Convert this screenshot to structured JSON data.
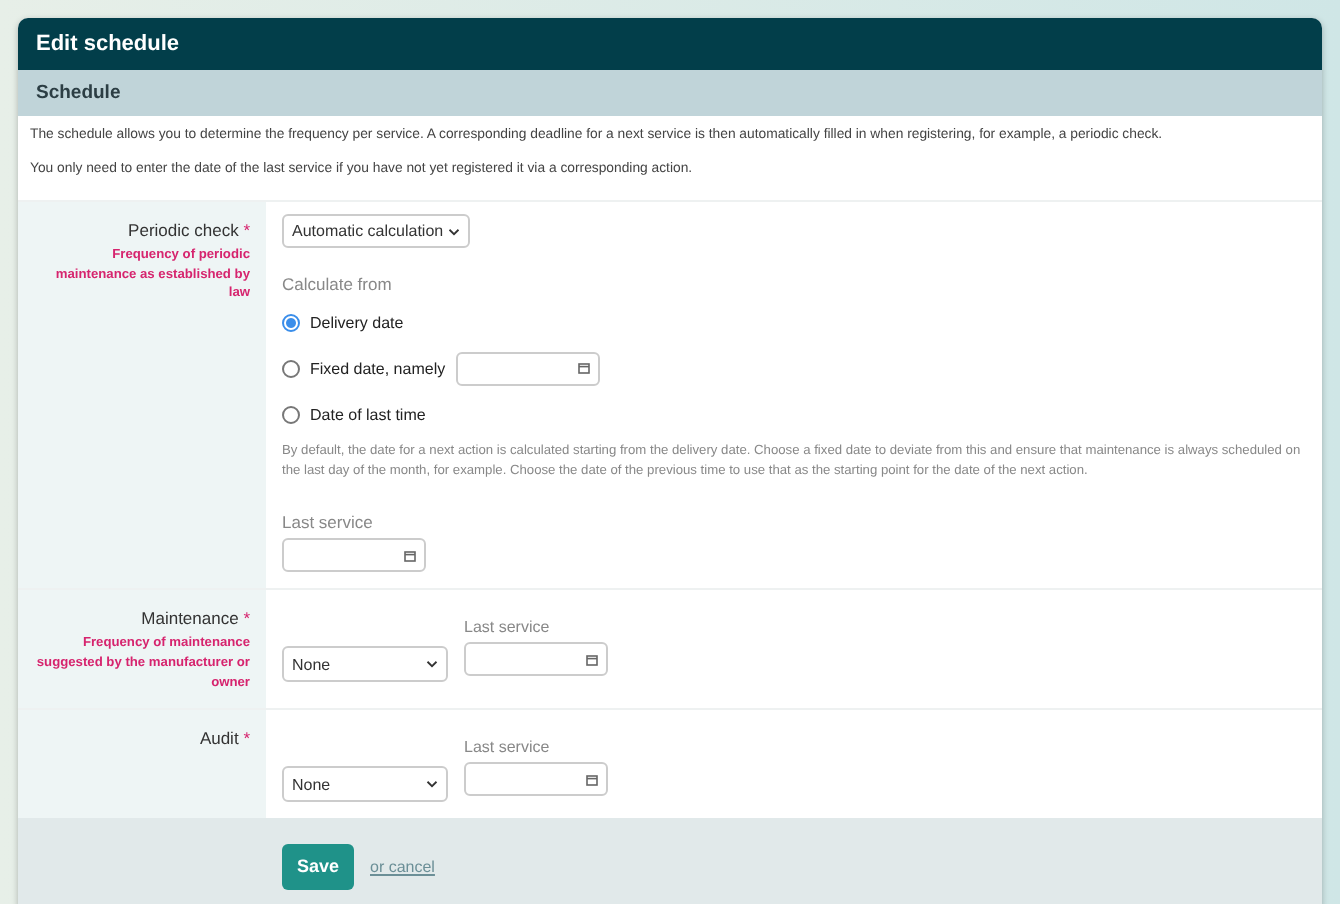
{
  "window": {
    "title": "Edit schedule"
  },
  "section": {
    "title": "Schedule"
  },
  "intro": [
    "The schedule allows you to determine the frequency per service. A corresponding deadline for a next service is then automatically filled in when registering, for example, a periodic check.",
    "You only need to enter the date of the last service if you have not yet registered it via a corresponding action."
  ],
  "rows": [
    {
      "kind": "periodic",
      "label": "Periodic check",
      "asterisk": "*",
      "hint": "Frequency of periodic maintenance as established by law",
      "select": "Automatic calculation",
      "calculate_title": "Calculate from",
      "options": [
        {
          "label": "Delivery date",
          "selected": true,
          "date_field": false
        },
        {
          "label": "Fixed date, namely",
          "selected": false,
          "date_field": true
        },
        {
          "label": "Date of last time",
          "selected": false,
          "date_field": false
        }
      ],
      "help": "By default, the date for a next action is calculated starting from the delivery date. Choose a fixed date to deviate from this and ensure that maintenance is always scheduled on the last day of the month, for example. Choose the date of the previous time to use that as the starting point for the date of the next action.",
      "last_service": "Last service"
    },
    {
      "kind": "simple",
      "label": "Maintenance",
      "asterisk": "*",
      "hint": "Frequency of maintenance suggested by the manufacturer or owner",
      "select": "None",
      "last_service": "Last service"
    },
    {
      "kind": "simple",
      "label": "Audit",
      "asterisk": "*",
      "select": "None",
      "last_service": "Last service"
    }
  ],
  "footer": {
    "save": "Save",
    "cancel": "or cancel"
  }
}
